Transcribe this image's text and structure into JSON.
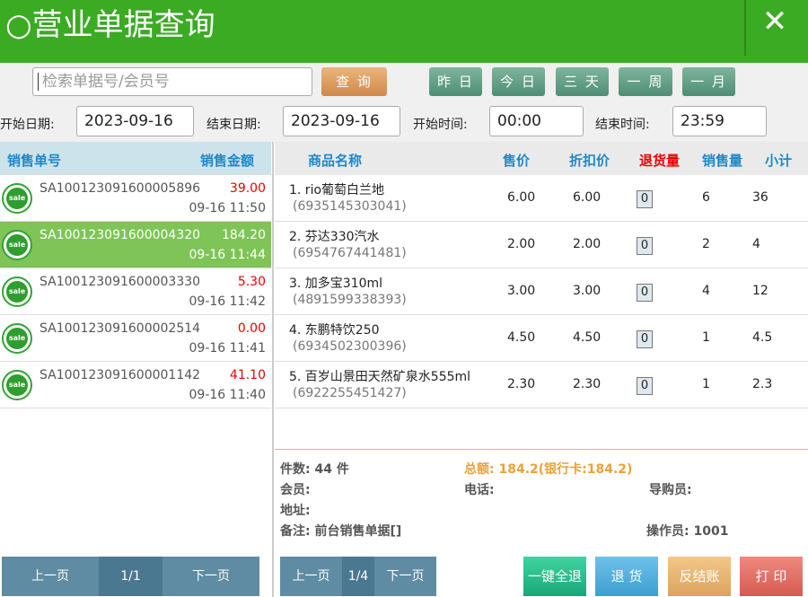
{
  "header": {
    "title": "○营业单据查询",
    "close": "✕"
  },
  "search": {
    "placeholder": "检索单据号/会员号",
    "query_label": "查 询"
  },
  "quick": [
    "昨 日",
    "今 日",
    "三 天",
    "一 周",
    "一 月"
  ],
  "filters": {
    "start_date_label": "开始日期:",
    "start_date": "2023-09-16",
    "end_date_label": "结束日期:",
    "end_date": "2023-09-16",
    "start_time_label": "开始时间:",
    "start_time": "00:00",
    "end_time_label": "结束时间:",
    "end_time": "23:59"
  },
  "left_headers": {
    "no": "销售单号",
    "amount": "销售金额"
  },
  "orders": [
    {
      "no": "SA100123091600005896",
      "amount": "39.00",
      "time": "09-16 11:50",
      "badge": "sale"
    },
    {
      "no": "SA100123091600004320",
      "amount": "184.20",
      "time": "09-16 11:44",
      "badge": "sale"
    },
    {
      "no": "SA100123091600003330",
      "amount": "5.30",
      "time": "09-16 11:42",
      "badge": "sale"
    },
    {
      "no": "SA100123091600002514",
      "amount": "0.00",
      "time": "09-16 11:41",
      "badge": "sale"
    },
    {
      "no": "SA100123091600001142",
      "amount": "41.10",
      "time": "09-16 11:40",
      "badge": "sale"
    }
  ],
  "right_headers": {
    "name": "商品名称",
    "price": "售价",
    "discount": "折扣价",
    "returned": "退货量",
    "qty": "销售量",
    "subtotal": "小计"
  },
  "items": [
    {
      "name": "1. rio葡萄白兰地",
      "barcode": "(6935145303041)",
      "price": "6.00",
      "discount": "6.00",
      "returned": "0",
      "qty": "6",
      "subtotal": "36"
    },
    {
      "name": "2. 芬达330汽水",
      "barcode": "(6954767441481)",
      "price": "2.00",
      "discount": "2.00",
      "returned": "0",
      "qty": "2",
      "subtotal": "4"
    },
    {
      "name": "3. 加多宝310ml",
      "barcode": "(4891599338393)",
      "price": "3.00",
      "discount": "3.00",
      "returned": "0",
      "qty": "4",
      "subtotal": "12"
    },
    {
      "name": "4. 东鹏特饮250",
      "barcode": "(6934502300396)",
      "price": "4.50",
      "discount": "4.50",
      "returned": "0",
      "qty": "1",
      "subtotal": "4.5"
    },
    {
      "name": "5. 百岁山景田天然矿泉水555ml",
      "barcode": "(6922255451427)",
      "price": "2.30",
      "discount": "2.30",
      "returned": "0",
      "qty": "1",
      "subtotal": "2.3"
    }
  ],
  "summary": {
    "count": "件数: 44 件",
    "total": "总额: 184.2(银行卡:184.2)",
    "member": "会员:",
    "phone": "电话:",
    "guide": "导购员:",
    "address": "地址:",
    "note": "备注: 前台销售单据[]",
    "operator": "操作员: 1001"
  },
  "left_pager": {
    "prev": "上一页",
    "page": "1/1",
    "next": "下一页"
  },
  "right_pager": {
    "prev": "上一页",
    "page": "1/4",
    "next": "下一页"
  },
  "actions": {
    "refund_all": "一键全退",
    "return": "退 货",
    "reverse": "反结账",
    "print": "打 印"
  }
}
